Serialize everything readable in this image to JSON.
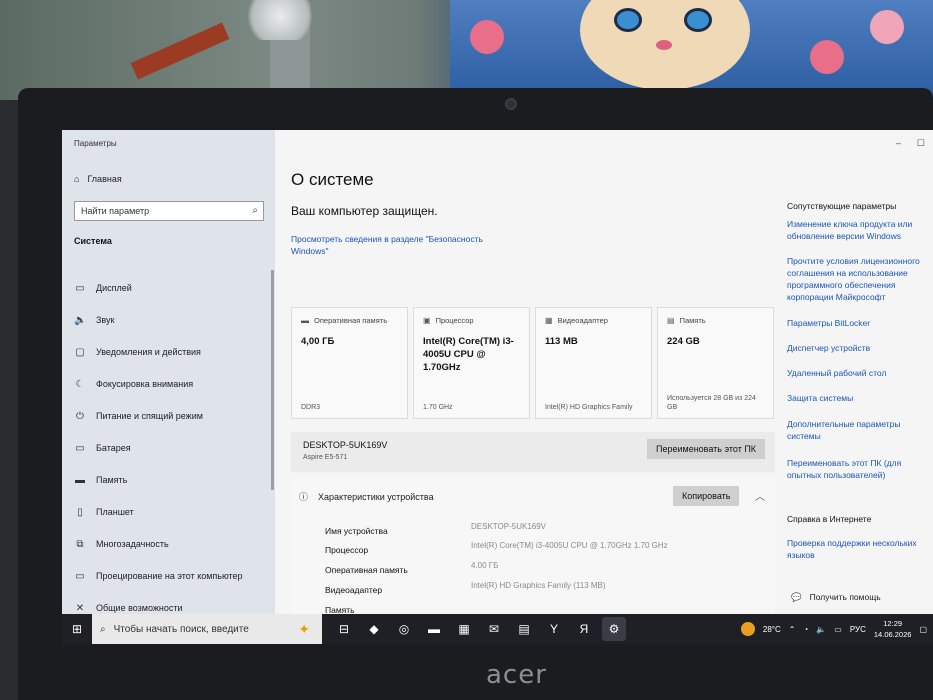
{
  "window": {
    "title": "Параметры",
    "controls": [
      "–",
      "☐"
    ]
  },
  "sidebar": {
    "home": "Главная",
    "search_placeholder": "Найти параметр",
    "section": "Система",
    "items": [
      {
        "label": "Дисплей",
        "icon": "display-icon",
        "glyph": "▭"
      },
      {
        "label": "Звук",
        "icon": "sound-icon",
        "glyph": "🔈"
      },
      {
        "label": "Уведомления и действия",
        "icon": "notifications-icon",
        "glyph": "▢"
      },
      {
        "label": "Фокусировка внимания",
        "icon": "moon-icon",
        "glyph": "☾"
      },
      {
        "label": "Питание и спящий режим",
        "icon": "power-icon",
        "glyph": "⏻"
      },
      {
        "label": "Батарея",
        "icon": "battery-icon",
        "glyph": "▭"
      },
      {
        "label": "Память",
        "icon": "storage-icon",
        "glyph": "▬"
      },
      {
        "label": "Планшет",
        "icon": "tablet-icon",
        "glyph": "▯"
      },
      {
        "label": "Многозадачность",
        "icon": "multitask-icon",
        "glyph": "⧉"
      },
      {
        "label": "Проецирование на этот компьютер",
        "icon": "project-icon",
        "glyph": "▭"
      },
      {
        "label": "Общие возможности",
        "icon": "shared-icon",
        "glyph": "✕"
      }
    ]
  },
  "main": {
    "title": "О системе",
    "protected": "Ваш компьютер защищен.",
    "security_link": "Просмотреть сведения в разделе \"Безопасность Windows\"",
    "cards": [
      {
        "head": "Оперативная память",
        "icon": "ram-icon",
        "glyph": "▬",
        "value": "4,00 ГБ",
        "sub": "DDR3"
      },
      {
        "head": "Процессор",
        "icon": "cpu-icon",
        "glyph": "▣",
        "value": "Intel(R) Core(TM) i3-4005U CPU @ 1.70GHz",
        "sub": "1.70 GHz"
      },
      {
        "head": "Видеоадаптер",
        "icon": "gpu-icon",
        "glyph": "▦",
        "value": "113 MB",
        "sub": "Intel(R) HD Graphics Family"
      },
      {
        "head": "Память",
        "icon": "disk-icon",
        "glyph": "▤",
        "value": "224 GB",
        "sub": "Используется 28 GB из 224 GB"
      }
    ],
    "pc_name": "DESKTOP-5UK169V",
    "pc_model": "Aspire E5-571",
    "rename_button": "Переименовать этот ПК",
    "specs_title": "Характеристики устройства",
    "copy_button": "Копировать",
    "specs": [
      {
        "label": "Имя устройства",
        "value": "DESKTOP-5UK169V"
      },
      {
        "label": "Процессор",
        "value": "Intel(R) Core(TM) i3-4005U CPU @ 1.70GHz   1.70 GHz"
      },
      {
        "label": "Оперативная память",
        "value": "4.00 ГБ"
      },
      {
        "label": "Видеоадаптер",
        "value": "Intel(R) HD Graphics Family (113 MB)"
      },
      {
        "label": "Память",
        "value": ""
      }
    ]
  },
  "related": {
    "heading": "Сопутствующие параметры",
    "links": [
      "Изменение ключа продукта или обновление версии Windows",
      "Прочтите условия лицензионного соглашения на использование программного обеспечения корпорации Майкрософт",
      "Параметры BitLocker",
      "Диспетчер устройств",
      "Удаленный рабочий стол",
      "Защита системы",
      "Дополнительные параметры системы",
      "Переименовать этот ПК (для опытных пользователей)"
    ],
    "help_heading": "Справка в Интернете",
    "help_links": [
      "Проверка поддержки нескольких языков"
    ],
    "get_help": "Получить помощь"
  },
  "taskbar": {
    "search_placeholder": "Чтобы начать поиск, введите",
    "apps": [
      {
        "icon": "task-view-icon",
        "glyph": "⊟"
      },
      {
        "icon": "copilot-icon",
        "glyph": "◆"
      },
      {
        "icon": "edge-icon",
        "glyph": "◎"
      },
      {
        "icon": "explorer-icon",
        "glyph": "▬"
      },
      {
        "icon": "store-icon",
        "glyph": "▦"
      },
      {
        "icon": "mail-icon",
        "glyph": "✉"
      },
      {
        "icon": "weather-app-icon",
        "glyph": "▤"
      },
      {
        "icon": "yandex-browser-icon",
        "glyph": "Y"
      },
      {
        "icon": "yandex-icon",
        "glyph": "Я"
      },
      {
        "icon": "settings-icon",
        "glyph": "⚙"
      }
    ],
    "temperature": "28°C",
    "language": "РУС",
    "time": "12:29",
    "date": "14.06.2026"
  },
  "colors": {
    "link": "#1a56b8",
    "sidebar_bg": "#dfe3ea",
    "taskbar_bg": "#1e2026"
  }
}
